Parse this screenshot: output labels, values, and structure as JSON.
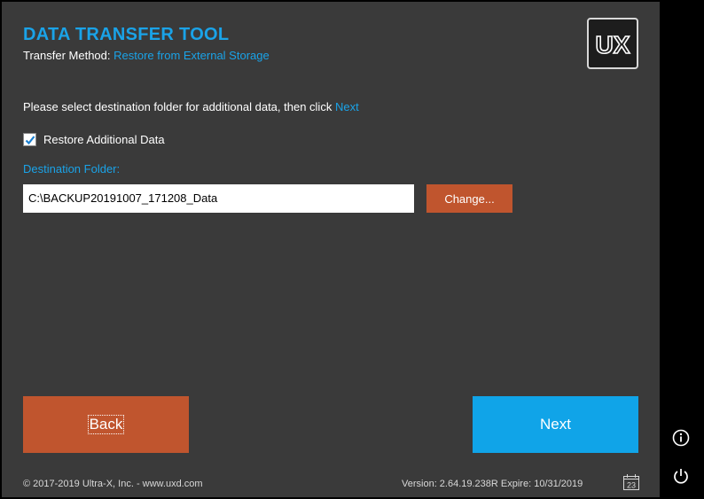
{
  "app": {
    "title": "DATA TRANSFER TOOL",
    "method_label": "Transfer Method:",
    "method_value": "Restore from External Storage",
    "logo_text": "UX"
  },
  "form": {
    "instruction": "Please select destination folder for additional data, then click",
    "instruction_link": "Next",
    "checkbox_label": "Restore Additional Data",
    "checkbox_checked": true,
    "dest_label": "Destination Folder:",
    "dest_value": "C:\\BACKUP20191007_171208_Data",
    "change_label": "Change..."
  },
  "nav": {
    "back_label": "Back",
    "next_label": "Next"
  },
  "footer": {
    "copyright": "© 2017-2019 Ultra-X, Inc. - www.uxd.com",
    "version": "Version: 2.64.19.238R Expire: 10/31/2019",
    "calendar_day": "23"
  },
  "sidebar": {
    "icons": [
      "info-icon",
      "power-icon"
    ]
  },
  "colors": {
    "accent": "#1aa3e8",
    "orange": "#c0552e",
    "next_blue": "#10a4e8",
    "background": "#3a3a3a"
  }
}
